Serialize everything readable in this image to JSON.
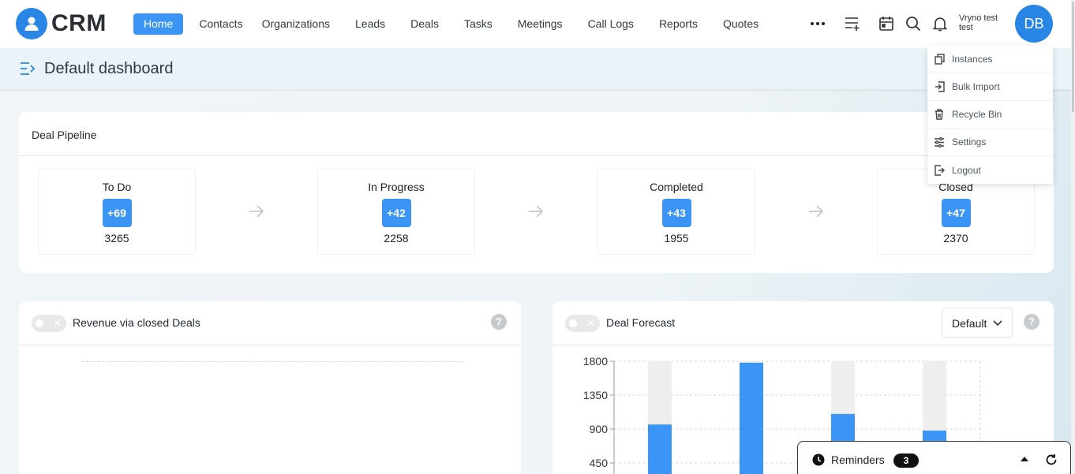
{
  "app": {
    "logo_text": "CRM"
  },
  "nav": {
    "items": [
      {
        "label": "Home"
      },
      {
        "label": "Contacts"
      },
      {
        "label": "Organizations"
      },
      {
        "label": "Leads"
      },
      {
        "label": "Deals"
      },
      {
        "label": "Tasks"
      },
      {
        "label": "Meetings"
      },
      {
        "label": "Call Logs"
      },
      {
        "label": "Reports"
      },
      {
        "label": "Quotes"
      }
    ],
    "more_icon": "more-horizontal-icon",
    "icons": [
      "add-list-icon",
      "calendar-icon",
      "search-icon",
      "bell-icon"
    ]
  },
  "user": {
    "name_line1": "Vryno test",
    "name_line2": "test",
    "initials": "DB"
  },
  "page": {
    "title": "Default dashboard"
  },
  "user_menu": {
    "items": [
      {
        "label": "Instances",
        "icon": "copy-icon"
      },
      {
        "label": "Bulk Import",
        "icon": "import-icon"
      },
      {
        "label": "Recycle Bin",
        "icon": "trash-icon"
      },
      {
        "label": "Settings",
        "icon": "sliders-icon"
      },
      {
        "label": "Logout",
        "icon": "logout-icon"
      }
    ]
  },
  "pipeline": {
    "title": "Deal Pipeline",
    "stages": [
      {
        "name": "To Do",
        "delta": "+69",
        "count": "3265"
      },
      {
        "name": "In Progress",
        "delta": "+42",
        "count": "2258"
      },
      {
        "name": "Completed",
        "delta": "+43",
        "count": "1955"
      },
      {
        "name": "Closed",
        "delta": "+47",
        "count": "2370"
      }
    ]
  },
  "revenue": {
    "title": "Revenue via closed Deals",
    "help": "?"
  },
  "forecast": {
    "title": "Deal Forecast",
    "dropdown_value": "Default",
    "help": "?",
    "chart_data": {
      "type": "bar",
      "yticks": [
        1800,
        1350,
        900,
        450
      ],
      "ylim": [
        0,
        1800
      ],
      "grid": true,
      "bars": [
        {
          "value": 960,
          "max": 1800
        },
        {
          "value": 1780,
          "max": 1800
        },
        {
          "value": 1100,
          "max": 1800
        },
        {
          "value": 880,
          "max": 1800
        }
      ]
    }
  },
  "reminders": {
    "label": "Reminders",
    "count": "3"
  },
  "colors": {
    "primary": "#3b95f5",
    "bar": "#3a95f6",
    "bar_bg": "#eeeeee"
  }
}
